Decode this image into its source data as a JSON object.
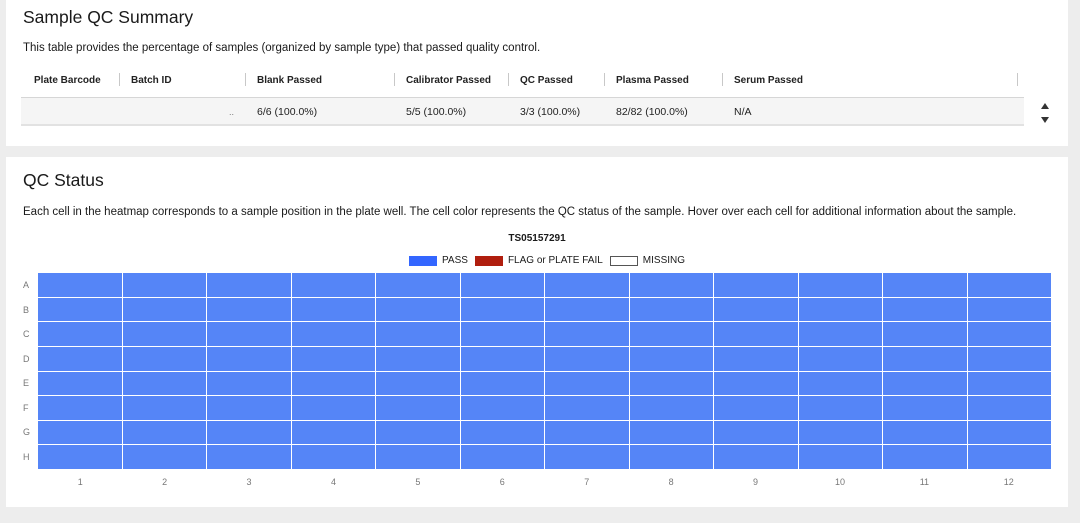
{
  "summary": {
    "title": "Sample QC Summary",
    "description": "This table provides the percentage of samples (organized by sample type) that passed quality control.",
    "columns": [
      "Plate Barcode",
      "Batch ID",
      "Blank Passed",
      "Calibrator Passed",
      "QC Passed",
      "Plasma Passed",
      "Serum Passed"
    ],
    "row": {
      "plate_barcode": "",
      "batch_id": "",
      "truncation": "..",
      "blank_passed": "6/6 (100.0%)",
      "calibrator_passed": "5/5 (100.0%)",
      "qc_passed": "3/3 (100.0%)",
      "plasma_passed": "82/82 (100.0%)",
      "serum_passed": "N/A"
    }
  },
  "qc_status": {
    "title": "QC Status",
    "description": "Each cell in the heatmap corresponds to a sample position in the plate well. The cell color represents the QC status of the sample. Hover over each cell for additional information about the sample.",
    "plate_barcode": "TS05157291",
    "legend": {
      "pass": "PASS",
      "flag": "FLAG or PLATE FAIL",
      "missing": "MISSING"
    },
    "colors": {
      "pass": "#5585f7",
      "flag": "#b01e0e",
      "missing": "#ffffff"
    },
    "rows": [
      "A",
      "B",
      "C",
      "D",
      "E",
      "F",
      "G",
      "H"
    ],
    "columns": [
      "1",
      "2",
      "3",
      "4",
      "5",
      "6",
      "7",
      "8",
      "9",
      "10",
      "11",
      "12"
    ],
    "status": "PASS"
  }
}
